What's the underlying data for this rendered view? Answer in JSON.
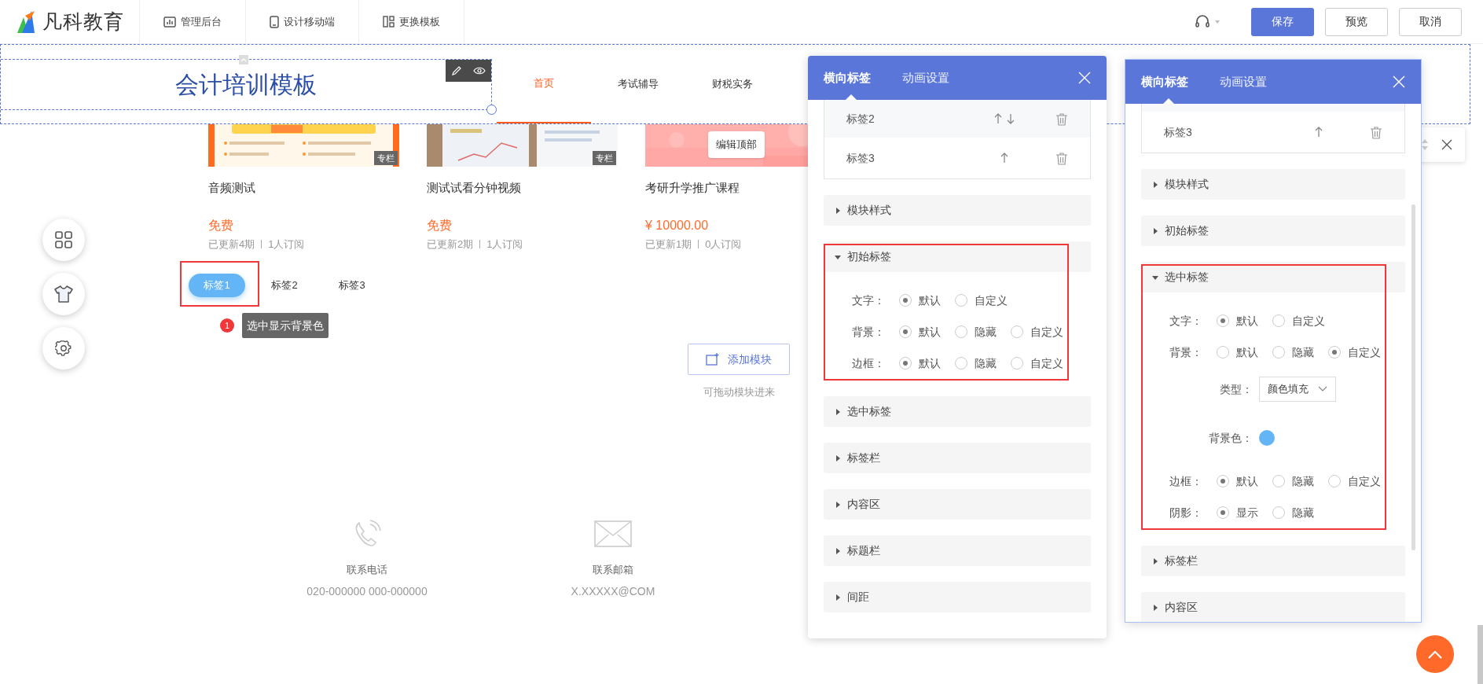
{
  "topbar": {
    "logo": "凡科教育",
    "nav": [
      {
        "label": "管理后台",
        "kind": "chart"
      },
      {
        "label": "设计移动端",
        "kind": "phone"
      },
      {
        "label": "更换模板",
        "kind": "layout"
      }
    ],
    "actions": [
      {
        "label": "保存",
        "kind": "primary"
      },
      {
        "label": "预览",
        "kind": "default"
      },
      {
        "label": "取消",
        "kind": "default"
      }
    ]
  },
  "site_header": {
    "title": "会计培训模板",
    "nav": [
      {
        "label": "首页",
        "selected": true
      },
      {
        "label": "考试辅导",
        "selected": false
      },
      {
        "label": "财税实务",
        "selected": false
      }
    ]
  },
  "courses": [
    {
      "title": "音频测试",
      "price": "免费",
      "updates": "已更新4期",
      "subscribers": "1人订阅",
      "badge": "专栏",
      "kind": "poster"
    },
    {
      "title": "测试试看分钟视频",
      "price": "免费",
      "updates": "已更新2期",
      "subscribers": "1人订阅",
      "badge": "专栏",
      "kind": "desk"
    },
    {
      "title": "考研升学推广课程",
      "price": "¥ 10000.00",
      "updates": "已更新1期",
      "subscribers": "0人订阅",
      "kind": "pink"
    }
  ],
  "edit_top_button": "编辑顶部",
  "tabs": [
    {
      "label": "标签1",
      "selected": true
    },
    {
      "label": "标签2",
      "selected": false
    },
    {
      "label": "标签3",
      "selected": false
    }
  ],
  "tooltip": {
    "number": "1",
    "text": "选中显示背景色"
  },
  "add_module": {
    "label": "添加模块",
    "hint": "可拖动模块进来"
  },
  "contacts": [
    {
      "label": "联系电话",
      "value": "020-000000 000-000000",
      "kind": "phone"
    },
    {
      "label": "联系邮箱",
      "value": "X.XXXXX@COM",
      "kind": "email"
    }
  ],
  "panels": [
    {
      "tabs": [
        {
          "label": "横向标签",
          "selected": true
        },
        {
          "label": "动画设置",
          "selected": false
        }
      ],
      "cut_row": false,
      "tag_rows": [
        {
          "label": "标签2",
          "up": true,
          "down": true
        },
        {
          "label": "标签3",
          "up": true,
          "down": false
        }
      ],
      "sections": [
        {
          "title": "模块样式",
          "expanded": false,
          "annotated": false
        },
        {
          "title": "初始标签",
          "expanded": true,
          "annotated": true,
          "fields": [
            {
              "kind": "radio",
              "label": "文字：",
              "options": [
                {
                  "label": "默认",
                  "selected": true
                },
                {
                  "label": "自定义",
                  "selected": false
                }
              ]
            },
            {
              "kind": "radio",
              "label": "背景：",
              "options": [
                {
                  "label": "默认",
                  "selected": true
                },
                {
                  "label": "隐藏",
                  "selected": false
                },
                {
                  "label": "自定义",
                  "selected": false
                }
              ]
            },
            {
              "kind": "radio",
              "label": "边框：",
              "options": [
                {
                  "label": "默认",
                  "selected": true
                },
                {
                  "label": "隐藏",
                  "selected": false
                },
                {
                  "label": "自定义",
                  "selected": false
                }
              ]
            }
          ]
        },
        {
          "title": "选中标签",
          "expanded": false,
          "annotated": false
        },
        {
          "title": "标签栏",
          "expanded": false,
          "annotated": false
        },
        {
          "title": "内容区",
          "expanded": false,
          "annotated": false
        },
        {
          "title": "标题栏",
          "expanded": false,
          "annotated": false
        },
        {
          "title": "间距",
          "expanded": false,
          "annotated": false
        }
      ]
    },
    {
      "tabs": [
        {
          "label": "横向标签",
          "selected": true
        },
        {
          "label": "动画设置",
          "selected": false
        }
      ],
      "cut_row": true,
      "tag_rows": [
        {
          "label": "标签3",
          "up": true,
          "down": false
        }
      ],
      "sections": [
        {
          "title": "模块样式",
          "expanded": false,
          "annotated": false
        },
        {
          "title": "初始标签",
          "expanded": false,
          "annotated": false
        },
        {
          "title": "选中标签",
          "expanded": true,
          "annotated": true,
          "fields": [
            {
              "kind": "radio",
              "label": "文字：",
              "options": [
                {
                  "label": "默认",
                  "selected": true
                },
                {
                  "label": "自定义",
                  "selected": false
                }
              ]
            },
            {
              "kind": "radio",
              "label": "背景：",
              "options": [
                {
                  "label": "默认",
                  "selected": false
                },
                {
                  "label": "隐藏",
                  "selected": false
                },
                {
                  "label": "自定义",
                  "selected": true
                }
              ]
            },
            {
              "kind": "select",
              "label": "类型：",
              "value": "颜色填充"
            },
            {
              "kind": "color",
              "label": "背景色：",
              "color": "#64b5f6"
            },
            {
              "kind": "radio",
              "label": "边框：",
              "options": [
                {
                  "label": "默认",
                  "selected": true
                },
                {
                  "label": "隐藏",
                  "selected": false
                },
                {
                  "label": "自定义",
                  "selected": false
                }
              ]
            },
            {
              "kind": "radio",
              "label": "阴影：",
              "options": [
                {
                  "label": "显示",
                  "selected": true
                },
                {
                  "label": "隐藏",
                  "selected": false
                }
              ]
            }
          ]
        },
        {
          "title": "标签栏",
          "expanded": false,
          "annotated": false
        },
        {
          "title": "内容区",
          "expanded": false,
          "annotated": false
        }
      ]
    }
  ]
}
